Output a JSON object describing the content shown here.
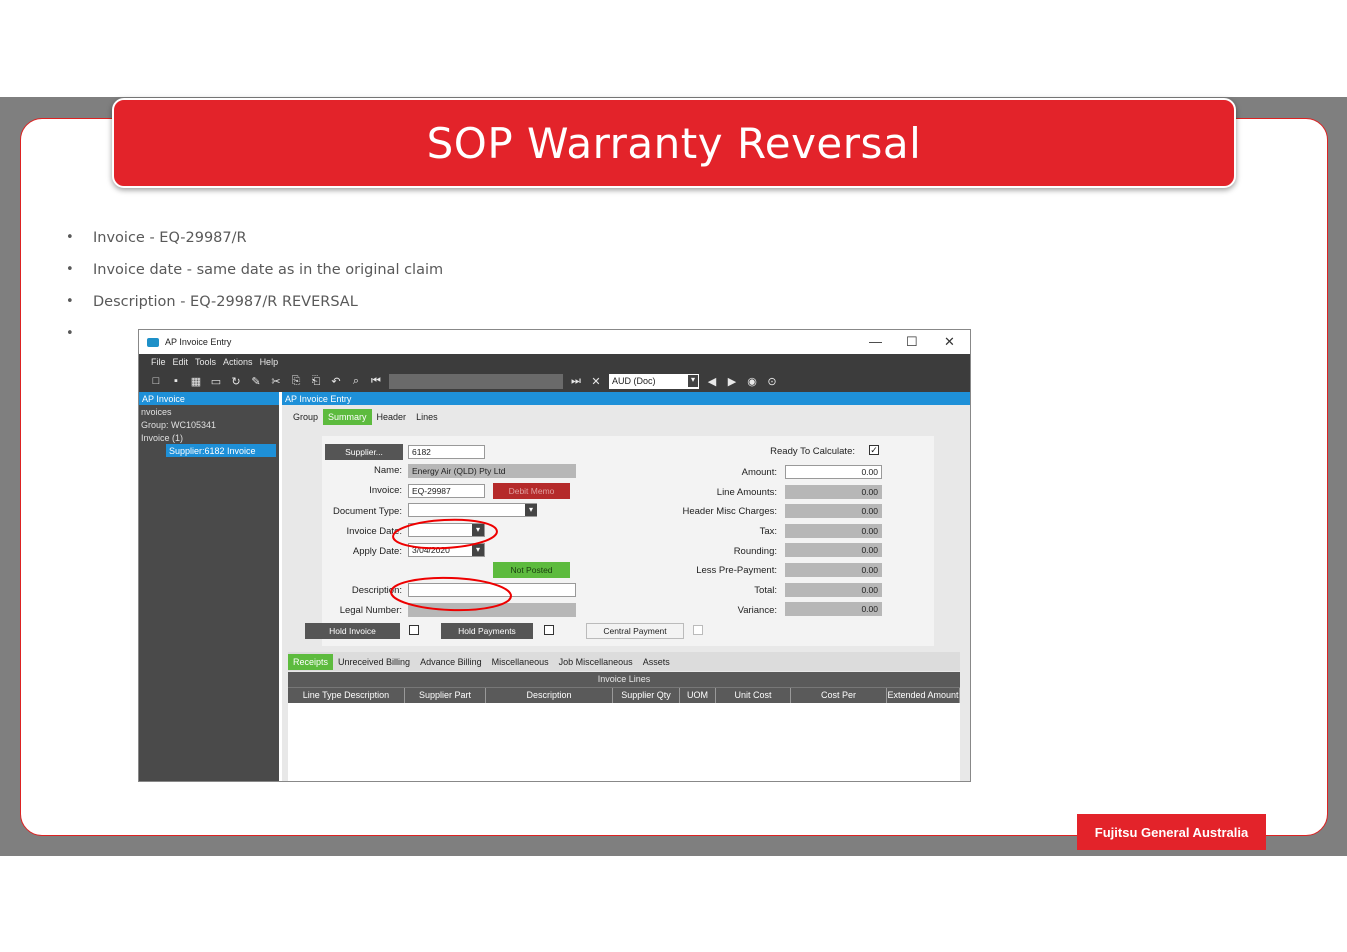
{
  "slide": {
    "title": "SOP Warranty Reversal",
    "bullets": [
      "Invoice  - EQ-29987/R",
      "Invoice date -  same date as in the original claim",
      "Description -  EQ-29987/R  REVERSAL",
      ""
    ],
    "footer": "Fujitsu General Australia"
  },
  "window": {
    "title": "AP Invoice Entry",
    "controls": [
      "—",
      "☐",
      "✕"
    ],
    "menu": [
      "File",
      "Edit",
      "Tools",
      "Actions",
      "Help"
    ],
    "currency": "AUD (Doc)"
  },
  "left_pane": {
    "header": "AP Invoice",
    "tree": [
      "nvoices",
      "Group: WC105341",
      "Invoice (1)",
      "Supplier:6182 Invoice"
    ]
  },
  "main_pane": {
    "header": "AP Invoice Entry",
    "tabs": [
      "Group",
      "Summary",
      "Header",
      "Lines"
    ],
    "active_tab": "Summary"
  },
  "form": {
    "supplier_button": "Supplier...",
    "supplier_value": "6182",
    "name_label": "Name:",
    "name_value": "Energy Air (QLD) Pty Ltd",
    "invoice_label": "Invoice:",
    "invoice_value": "EQ-29987",
    "debit_memo": "Debit Memo",
    "doc_type_label": "Document Type:",
    "invoice_date_label": "Invoice Date:",
    "apply_date_label": "Apply Date:",
    "apply_date_value": "3/04/2020",
    "status": "Not Posted",
    "description_label": "Description:",
    "legal_number_label": "Legal Number:",
    "hold_invoice": "Hold Invoice",
    "hold_payments": "Hold Payments",
    "central_payment": "Central Payment",
    "ready_label": "Ready To Calculate:",
    "totals": [
      {
        "label": "Amount:",
        "value": "0.00"
      },
      {
        "label": "Line Amounts:",
        "value": "0.00"
      },
      {
        "label": "Header Misc Charges:",
        "value": "0.00"
      },
      {
        "label": "Tax:",
        "value": "0.00"
      },
      {
        "label": "Rounding:",
        "value": "0.00"
      },
      {
        "label": "Less Pre-Payment:",
        "value": "0.00"
      },
      {
        "label": "Total:",
        "value": "0.00"
      },
      {
        "label": "Variance:",
        "value": "0.00"
      }
    ]
  },
  "subtabs": [
    "Receipts",
    "Unreceived Billing",
    "Advance Billing",
    "Miscellaneous",
    "Job Miscellaneous",
    "Assets"
  ],
  "grid": {
    "title": "Invoice Lines",
    "columns": [
      "Line Type Description",
      "Supplier Part",
      "Description",
      "Supplier Qty",
      "UOM",
      "Unit Cost",
      "Cost Per",
      "Extended Amount"
    ]
  },
  "colors": {
    "brand_red": "#e3232a",
    "accent_green": "#5dbb3e",
    "accent_blue": "#1e90d8"
  }
}
